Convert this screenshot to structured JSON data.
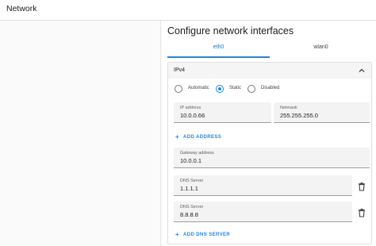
{
  "header": {
    "title": "Network"
  },
  "main": {
    "heading": "Configure network interfaces",
    "tabs": [
      {
        "label": "eth0",
        "active": true
      },
      {
        "label": "wlan0",
        "active": false
      }
    ],
    "card": {
      "title": "IPv4",
      "chevron_icon": "chevron-up-icon",
      "modes": [
        {
          "label": "Automatic",
          "selected": false
        },
        {
          "label": "Static",
          "selected": true
        },
        {
          "label": "Disabled",
          "selected": false
        }
      ],
      "ip_address": {
        "label": "IP address",
        "value": "10.0.0.66"
      },
      "netmask": {
        "label": "Netmask",
        "value": "255.255.255.0"
      },
      "add_address_label": "ADD ADDRESS",
      "gateway": {
        "label": "Gateway address",
        "value": "10.0.0.1"
      },
      "dns_servers": [
        {
          "label": "DNS Server",
          "value": "1.1.1.1"
        },
        {
          "label": "DNS Server",
          "value": "8.8.8.8"
        }
      ],
      "add_dns_label": "ADD DNS SERVER",
      "add_icon": "plus",
      "delete_icon": "trash-icon"
    }
  },
  "colors": {
    "accent": "#1e88e5",
    "field_bg": "#f3f3f3",
    "header_bg": "#f5f5f5"
  }
}
